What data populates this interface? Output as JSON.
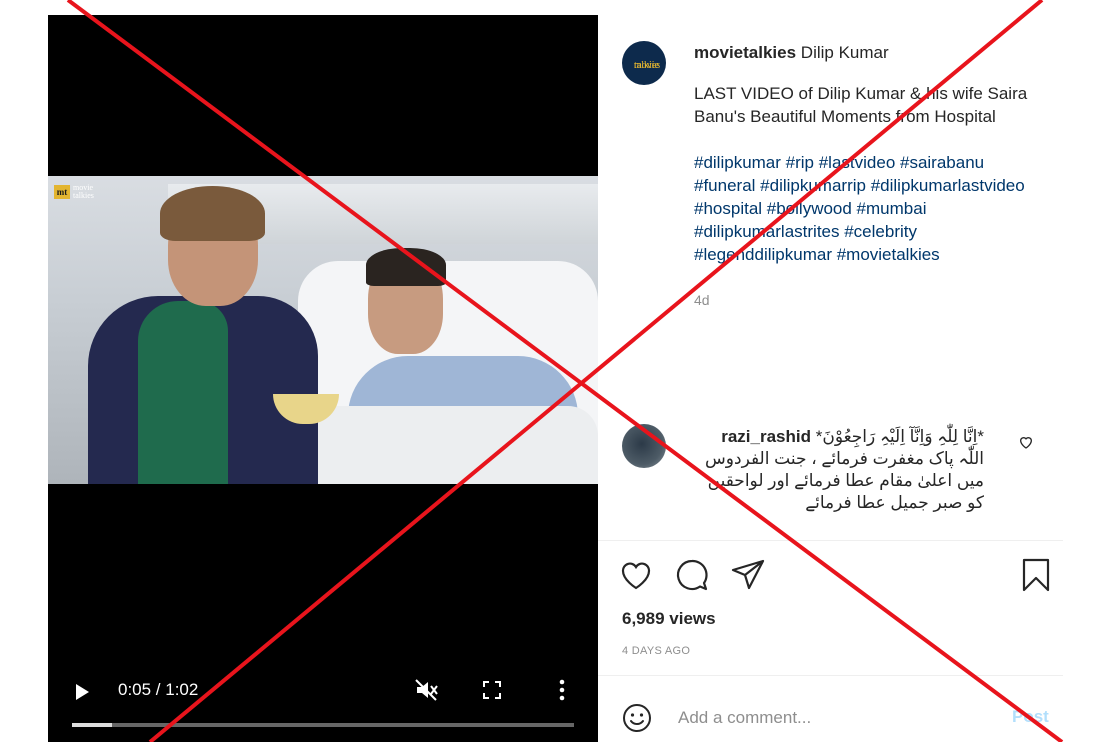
{
  "video": {
    "logo_mark": "mt",
    "logo_line1": "movie",
    "logo_line2": "talkies",
    "time": "0:05 / 1:02",
    "progress_fraction": 0.08
  },
  "post": {
    "avatar_text_line1": "movie",
    "avatar_text_line2": "talkies",
    "username": "movietalkies",
    "title_rest": "Dilip Kumar",
    "caption": "LAST VIDEO of Dilip Kumar & his wife Saira Banu's Beautiful Moments from Hospital",
    "hashtags": "#dilipkumar #rip #lastvideo #sairabanu #funeral #dilipkumarrip #dilipkumarlastvideo #hospital #bollywood #mumbai #dilipkumarlastrites #celebrity #legenddilipkumar #movietalkies",
    "age": "4d"
  },
  "comment": {
    "username": "razi_rashid",
    "text": "*اِنَّا لِلّٰہِ وَاِنَّآ اِلَیْہِ رَاجِعُوْنَ* اللّٰہ پاک مغفرت فرمائے ، جنت الفردوس میں اعلیٰ مقام عطا فرمائے اور لواحقین کو صبر جمیل عطا فرمائے"
  },
  "stats": {
    "views": "6,989 views",
    "ago": "4 DAYS AGO"
  },
  "add_comment": {
    "placeholder": "Add a comment...",
    "post_label": "Post"
  },
  "colors": {
    "hashtag": "#00376b",
    "post_disabled": "#b2dffc",
    "cross": "#e8141c"
  }
}
